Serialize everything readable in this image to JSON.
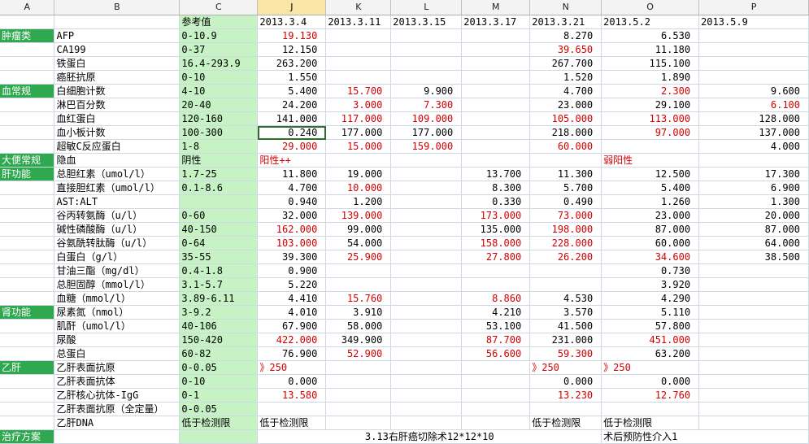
{
  "columns": [
    "A",
    "B",
    "C",
    "J",
    "K",
    "L",
    "M",
    "N",
    "O",
    "P"
  ],
  "active_column": "J",
  "ref_header": "参考值",
  "dates": [
    "2013.3.4",
    "2013.3.11",
    "2013.3.15",
    "2013.3.17",
    "2013.3.21",
    "2013.5.2",
    "2013.5.9"
  ],
  "colors": {
    "category": "#2fa84f",
    "ref_bg": "#c6f2c4",
    "abnormal": "#d40000"
  },
  "rows": [
    {
      "cat": "肿瘤类",
      "name": "AFP",
      "ref": "0-10.9",
      "vals": [
        "19.130",
        "",
        "",
        "",
        "8.270",
        "6.530",
        ""
      ],
      "red": [
        0
      ]
    },
    {
      "cat": "",
      "name": "CA199",
      "ref": "0-37",
      "vals": [
        "12.150",
        "",
        "",
        "",
        "39.650",
        "11.180",
        ""
      ],
      "red": [
        4
      ]
    },
    {
      "cat": "",
      "name": "铁蛋白",
      "ref": "16.4-293.9",
      "vals": [
        "263.200",
        "",
        "",
        "",
        "267.700",
        "115.100",
        ""
      ],
      "red": []
    },
    {
      "cat": "",
      "name": "癌胚抗原",
      "ref": "0-10",
      "vals": [
        "1.550",
        "",
        "",
        "",
        "1.520",
        "1.890",
        ""
      ],
      "red": []
    },
    {
      "cat": "血常规",
      "name": "白细胞计数",
      "ref": "4-10",
      "vals": [
        "5.400",
        "15.700",
        "9.900",
        "",
        "4.700",
        "2.300",
        "9.600"
      ],
      "red": [
        1,
        5
      ]
    },
    {
      "cat": "",
      "name": "淋巴百分数",
      "ref": "20-40",
      "vals": [
        "24.200",
        "3.000",
        "7.300",
        "",
        "23.000",
        "29.100",
        "6.100"
      ],
      "red": [
        1,
        2,
        6
      ]
    },
    {
      "cat": "",
      "name": "血红蛋白",
      "ref": "120-160",
      "vals": [
        "141.000",
        "117.000",
        "109.000",
        "",
        "105.000",
        "113.000",
        "128.000"
      ],
      "red": [
        1,
        2,
        4,
        5
      ]
    },
    {
      "cat": "",
      "name": "血小板计数",
      "ref": "100-300",
      "vals": [
        "0.240",
        "177.000",
        "177.000",
        "",
        "218.000",
        "97.000",
        "137.000"
      ],
      "red": [
        5
      ],
      "active": true
    },
    {
      "cat": "",
      "name": "超敏C反应蛋白",
      "ref": "1-8",
      "vals": [
        "29.000",
        "15.000",
        "159.000",
        "",
        "60.000",
        "",
        "4.000"
      ],
      "red": [
        0,
        1,
        2,
        4
      ]
    },
    {
      "cat": "大便常规",
      "name": "隐血",
      "ref": "阴性",
      "vals": [
        "阳性++",
        "",
        "",
        "",
        "",
        "弱阳性",
        ""
      ],
      "red": [
        0,
        5
      ],
      "textvals": true
    },
    {
      "cat": "肝功能",
      "name": "总胆红素（umol/l）",
      "ref": "1.7-25",
      "vals": [
        "11.800",
        "19.000",
        "",
        "13.700",
        "11.300",
        "12.500",
        "17.300"
      ],
      "red": []
    },
    {
      "cat": "",
      "name": "直接胆红素（umol/l）",
      "ref": "0.1-8.6",
      "vals": [
        "4.700",
        "10.000",
        "",
        "8.300",
        "5.700",
        "5.400",
        "6.900"
      ],
      "red": [
        1
      ]
    },
    {
      "cat": "",
      "name": "AST:ALT",
      "ref": "",
      "vals": [
        "0.940",
        "1.200",
        "",
        "0.330",
        "0.490",
        "1.260",
        "1.300"
      ],
      "red": []
    },
    {
      "cat": "",
      "name": "谷丙转氨酶（u/l）",
      "ref": "0-60",
      "vals": [
        "32.000",
        "139.000",
        "",
        "173.000",
        "73.000",
        "23.000",
        "20.000"
      ],
      "red": [
        1,
        3,
        4
      ]
    },
    {
      "cat": "",
      "name": "碱性磷酸酶（u/l）",
      "ref": "40-150",
      "vals": [
        "162.000",
        "99.000",
        "",
        "135.000",
        "198.000",
        "87.000",
        "87.000"
      ],
      "red": [
        0,
        4
      ]
    },
    {
      "cat": "",
      "name": "谷氨酰转肽酶（u/l）",
      "ref": "0-64",
      "vals": [
        "103.000",
        "54.000",
        "",
        "158.000",
        "228.000",
        "60.000",
        "64.000"
      ],
      "red": [
        0,
        3,
        4
      ]
    },
    {
      "cat": "",
      "name": "白蛋白（g/l）",
      "ref": "35-55",
      "vals": [
        "39.300",
        "25.900",
        "",
        "27.800",
        "26.200",
        "34.600",
        "38.500"
      ],
      "red": [
        1,
        3,
        4,
        5
      ]
    },
    {
      "cat": "",
      "name": "甘油三酯（mg/dl）",
      "ref": "0.4-1.8",
      "vals": [
        "0.900",
        "",
        "",
        "",
        "",
        "0.730",
        ""
      ],
      "red": []
    },
    {
      "cat": "",
      "name": "总胆固醇（mmol/l）",
      "ref": "3.1-5.7",
      "vals": [
        "5.220",
        "",
        "",
        "",
        "",
        "3.920",
        ""
      ],
      "red": []
    },
    {
      "cat": "",
      "name": "血糖（mmol/l）",
      "ref": "3.89-6.11",
      "vals": [
        "4.410",
        "15.760",
        "",
        "8.860",
        "4.530",
        "4.290",
        ""
      ],
      "red": [
        1,
        3
      ]
    },
    {
      "cat": "肾功能",
      "name": "尿素氮（nmol）",
      "ref": "3-9.2",
      "vals": [
        "4.010",
        "3.910",
        "",
        "4.210",
        "3.570",
        "5.110",
        ""
      ],
      "red": []
    },
    {
      "cat": "",
      "name": "肌酐（umol/l）",
      "ref": "40-106",
      "vals": [
        "67.900",
        "58.000",
        "",
        "53.100",
        "41.500",
        "57.800",
        ""
      ],
      "red": []
    },
    {
      "cat": "",
      "name": "尿酸",
      "ref": "150-420",
      "vals": [
        "422.000",
        "349.900",
        "",
        "87.700",
        "231.000",
        "451.000",
        ""
      ],
      "red": [
        0,
        3,
        5
      ]
    },
    {
      "cat": "",
      "name": "总蛋白",
      "ref": "60-82",
      "vals": [
        "76.900",
        "52.900",
        "",
        "56.600",
        "59.300",
        "63.200",
        ""
      ],
      "red": [
        1,
        3,
        4
      ]
    },
    {
      "cat": "乙肝",
      "name": "乙肝表面抗原",
      "ref": "0-0.05",
      "vals": [
        "》250",
        "",
        "",
        "",
        "》250",
        "》250",
        ""
      ],
      "red": [
        0,
        4,
        5
      ],
      "textvals": true
    },
    {
      "cat": "",
      "name": "乙肝表面抗体",
      "ref": "0-10",
      "vals": [
        "0.000",
        "",
        "",
        "",
        "0.000",
        "0.000",
        ""
      ],
      "red": []
    },
    {
      "cat": "",
      "name": "乙肝核心抗体-IgG",
      "ref": "0-1",
      "vals": [
        "13.580",
        "",
        "",
        "",
        "13.230",
        "12.760",
        ""
      ],
      "red": [
        0,
        4,
        5
      ]
    },
    {
      "cat": "",
      "name": "乙肝表面抗原（全定量）",
      "ref": "0-0.05",
      "vals": [
        "",
        "",
        "",
        "",
        "",
        "",
        ""
      ],
      "red": []
    },
    {
      "cat": "",
      "name": "乙肝DNA",
      "ref": "低于检测限",
      "vals": [
        "低于检测限",
        "",
        "",
        "",
        "低于检测限",
        "低于检测限",
        ""
      ],
      "red": [],
      "textvals": true
    }
  ],
  "treatment": {
    "cat": "治疗方案",
    "surgery": "3.13右肝癌切除术12*12*10",
    "intervention": "术后预防性介入1"
  }
}
